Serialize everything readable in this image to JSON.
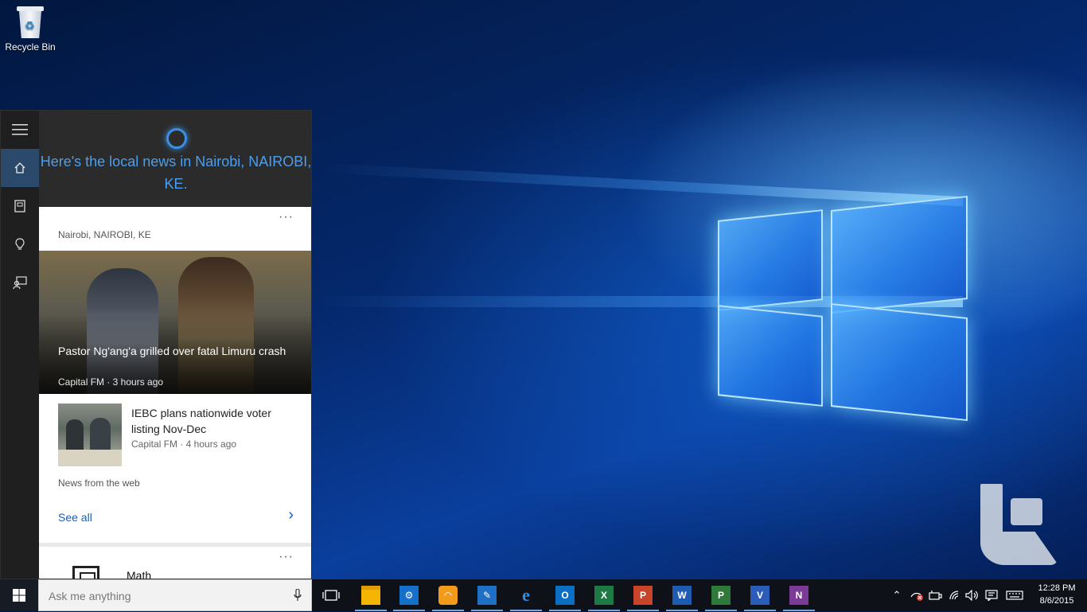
{
  "desktop": {
    "icons": [
      {
        "label": "Recycle Bin",
        "icon": "recycle-bin-icon"
      }
    ]
  },
  "cortana": {
    "greeting": "Here's the local news in Nairobi, NAIROBI, KE.",
    "rail": [
      "menu-icon",
      "home-icon",
      "notebook-icon",
      "reminders-icon",
      "feedback-icon"
    ],
    "news_card": {
      "menu": "···",
      "location": "Nairobi, NAIROBI, KE",
      "featured": {
        "title": "Pastor Ng'ang'a grilled over fatal Limuru crash",
        "source": "Capital FM · 3 hours ago"
      },
      "secondary": {
        "title": "IEBC plans nationwide voter listing Nov-Dec",
        "source": "Capital FM · 4 hours ago"
      },
      "footer": "News from the web",
      "see_all": "See all"
    },
    "math_card": {
      "menu": "···",
      "label": "Math"
    }
  },
  "taskbar": {
    "search_placeholder": "Ask me anything",
    "apps": [
      {
        "name": "task-view",
        "glyph": "",
        "color": ""
      },
      {
        "name": "file-explorer",
        "glyph": "",
        "color": "#f4b400"
      },
      {
        "name": "settings",
        "glyph": "⚙",
        "color": "#1570c9"
      },
      {
        "name": "firefox-developer",
        "glyph": "◠",
        "color": "#f29a1a"
      },
      {
        "name": "snipping-tool",
        "glyph": "✎",
        "color": "#1f6fc5"
      },
      {
        "name": "edge",
        "glyph": "e",
        "color": ""
      },
      {
        "name": "outlook",
        "glyph": "O",
        "color": "#0b6fc4"
      },
      {
        "name": "excel",
        "glyph": "X",
        "color": "#1d7a45"
      },
      {
        "name": "powerpoint",
        "glyph": "P",
        "color": "#c8442a"
      },
      {
        "name": "word",
        "glyph": "W",
        "color": "#1f5bb0"
      },
      {
        "name": "project",
        "glyph": "P",
        "color": "#2f7a3a"
      },
      {
        "name": "visio",
        "glyph": "V",
        "color": "#2b5cb8"
      },
      {
        "name": "onenote",
        "glyph": "N",
        "color": "#7b3a96"
      }
    ],
    "tray": [
      "chevron-up-icon",
      "network-error-icon",
      "power-icon",
      "wifi-icon",
      "volume-icon",
      "notifications-icon",
      "keyboard-icon"
    ],
    "time": "12:28 PM",
    "date": "8/6/2015"
  }
}
